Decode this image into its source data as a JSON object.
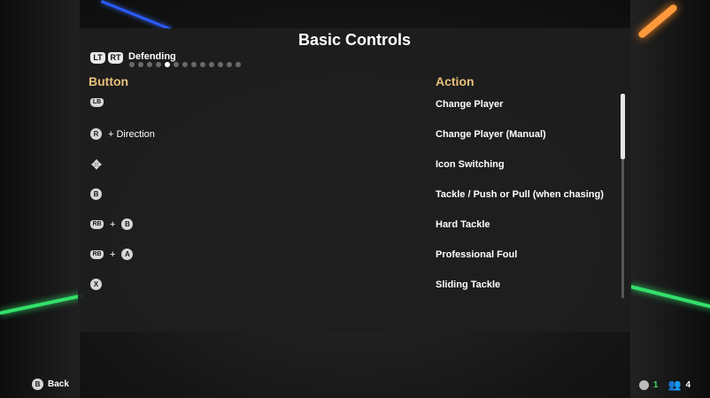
{
  "title": "Basic Controls",
  "header": {
    "left_bumper": "LT",
    "right_bumper": "RT",
    "category": "Defending",
    "pages": 13,
    "active_page": 4
  },
  "columns": {
    "button": "Button",
    "action": "Action"
  },
  "rows": [
    {
      "glyphs": [
        {
          "type": "pill",
          "label": "LB"
        }
      ],
      "action": "Change Player"
    },
    {
      "glyphs": [
        {
          "type": "round",
          "label": "R"
        },
        {
          "type": "text",
          "label": "+ Direction"
        }
      ],
      "action": "Change Player (Manual)"
    },
    {
      "glyphs": [
        {
          "type": "dpad",
          "label": "✥"
        }
      ],
      "action": "Icon Switching"
    },
    {
      "glyphs": [
        {
          "type": "round",
          "label": "B"
        }
      ],
      "action": "Tackle / Push or Pull (when chasing)"
    },
    {
      "glyphs": [
        {
          "type": "pill",
          "label": "RB"
        },
        {
          "type": "text",
          "label": "+"
        },
        {
          "type": "round",
          "label": "B"
        }
      ],
      "action": "Hard Tackle"
    },
    {
      "glyphs": [
        {
          "type": "pill",
          "label": "RB"
        },
        {
          "type": "text",
          "label": "+"
        },
        {
          "type": "round",
          "label": "A"
        }
      ],
      "action": "Professional Foul"
    },
    {
      "glyphs": [
        {
          "type": "round",
          "label": "X"
        }
      ],
      "action": "Sliding Tackle"
    }
  ],
  "footer": {
    "back_glyph": "B",
    "back_label": "Back",
    "status_count_1": "1",
    "status_count_2": "4"
  },
  "colors": {
    "accent": "#e8c07a",
    "active_dot": "#ffffff",
    "inactive_dot": "#6a6a6a"
  }
}
